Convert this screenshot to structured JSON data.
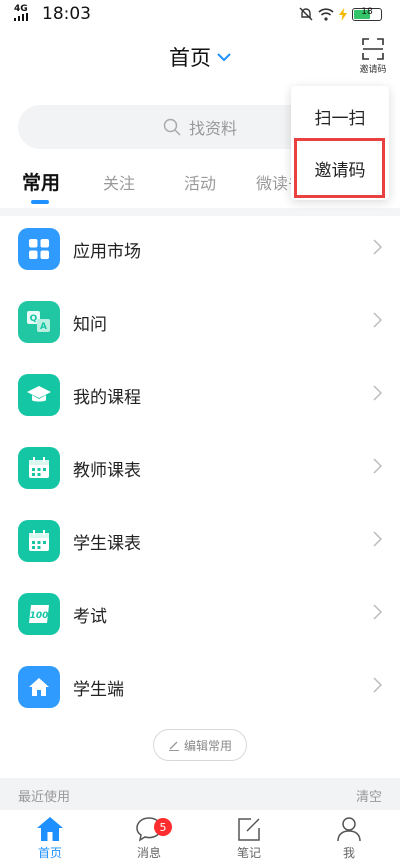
{
  "status_bar": {
    "time": "18:03",
    "signal": "4G",
    "battery": "18"
  },
  "header": {
    "title": "首页",
    "scan_label": "邀请码"
  },
  "search": {
    "placeholder": "找资料"
  },
  "tabs": [
    {
      "label": "常用",
      "active": true
    },
    {
      "label": "关注",
      "active": false
    },
    {
      "label": "活动",
      "active": false
    },
    {
      "label": "微读书",
      "active": false
    }
  ],
  "app_list": [
    {
      "label": "应用市场",
      "icon": "grid-icon",
      "color": "#2f9bff"
    },
    {
      "label": "知问",
      "icon": "qa-icon",
      "color": "#21c7a3"
    },
    {
      "label": "我的课程",
      "icon": "graduation-cap-icon",
      "color": "#15c6a4"
    },
    {
      "label": "教师课表",
      "icon": "calendar-icon",
      "color": "#15c6a4"
    },
    {
      "label": "学生课表",
      "icon": "calendar-icon",
      "color": "#15c6a4"
    },
    {
      "label": "考试",
      "icon": "exam-icon",
      "color": "#15c6a4"
    },
    {
      "label": "学生端",
      "icon": "home-icon",
      "color": "#2f9bff"
    }
  ],
  "edit_button": {
    "label": "编辑常用"
  },
  "recent": {
    "title": "最近使用",
    "clear": "清空"
  },
  "bottom_nav": [
    {
      "label": "首页",
      "icon": "home-icon",
      "active": true
    },
    {
      "label": "消息",
      "icon": "chat-icon",
      "active": false,
      "badge": "5"
    },
    {
      "label": "笔记",
      "icon": "note-icon",
      "active": false
    },
    {
      "label": "我",
      "icon": "person-icon",
      "active": false
    }
  ],
  "dropdown_menu": {
    "items": [
      "扫一扫",
      "邀请码"
    ],
    "highlighted": "邀请码"
  },
  "colors": {
    "accent": "#1e90ff",
    "teal": "#15c6a4",
    "highlight_border": "#e8413f",
    "badge": "#ff2d2d"
  }
}
